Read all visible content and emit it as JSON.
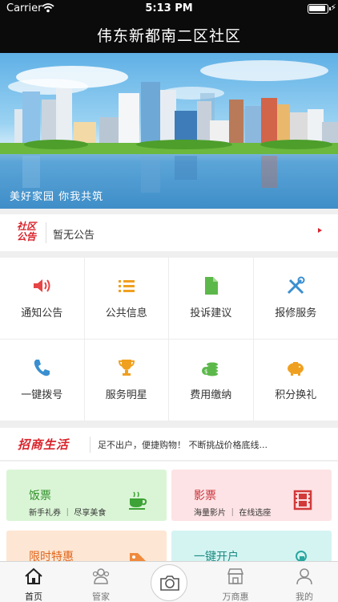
{
  "status_bar": {
    "carrier": "Carrier",
    "time": "5:13 PM"
  },
  "nav": {
    "title": "伟东新都南二区社区"
  },
  "banner": {
    "slogan": "美好家园  你我共筑"
  },
  "notice": {
    "logo_line1": "社区",
    "logo_line2": "公告",
    "text": "暂无公告"
  },
  "grid": {
    "items": [
      {
        "label": "通知公告",
        "icon": "speaker-icon",
        "color": "#e64545"
      },
      {
        "label": "公共信息",
        "icon": "list-icon",
        "color": "#f0a020"
      },
      {
        "label": "投诉建议",
        "icon": "document-icon",
        "color": "#5cb84a"
      },
      {
        "label": "报修服务",
        "icon": "tools-icon",
        "color": "#3a8fd0"
      },
      {
        "label": "一键拨号",
        "icon": "phone-icon",
        "color": "#3a8fd0"
      },
      {
        "label": "服务明星",
        "icon": "trophy-icon",
        "color": "#f0a020"
      },
      {
        "label": "费用缴纳",
        "icon": "coins-icon",
        "color": "#5cb84a"
      },
      {
        "label": "积分换礼",
        "icon": "piggy-bank-icon",
        "color": "#f0a020"
      }
    ]
  },
  "shop": {
    "logo": "招商生活",
    "text": "足不出户，便捷购物！ 不断挑战价格底线..."
  },
  "cards": [
    {
      "title": "饭票",
      "subtitle": "新手礼券 ｜ 尽享美食",
      "icon": "coffee-cup-icon"
    },
    {
      "title": "影票",
      "subtitle": "海量影片 ｜ 在线选座",
      "icon": "film-icon"
    },
    {
      "title": "限时特惠",
      "subtitle": "",
      "icon": "price-tag-icon"
    },
    {
      "title": "一键开户",
      "subtitle": "",
      "icon": "tap-hand-icon"
    }
  ],
  "tabbar": {
    "items": [
      {
        "label": "首页",
        "icon": "home-icon"
      },
      {
        "label": "管家",
        "icon": "people-icon"
      },
      {
        "label": "",
        "icon": "camera-icon"
      },
      {
        "label": "万商惠",
        "icon": "store-icon"
      },
      {
        "label": "我的",
        "icon": "person-icon"
      }
    ]
  }
}
